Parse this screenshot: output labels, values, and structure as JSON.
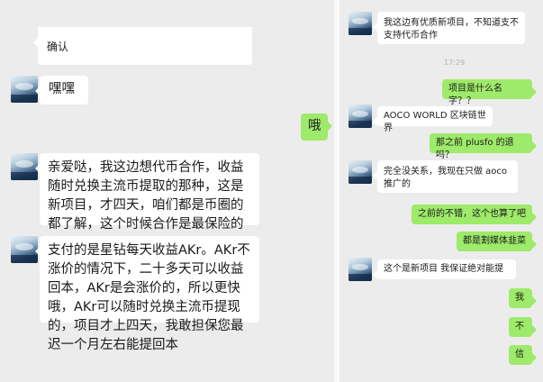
{
  "left_chat": {
    "messages": [
      {
        "side": "other",
        "text": "确认"
      },
      {
        "side": "other",
        "text": "嘿嘿"
      },
      {
        "side": "self",
        "text": "哦"
      },
      {
        "side": "other",
        "text": "亲爱哒，我这边想代币合作，收益随时兑换主流币提取的那种，这是新项目，才四天，咱们都是币圈的都了解，这个时候合作是最保险的"
      },
      {
        "side": "other",
        "text": "支付的是星钻每天收益AKr。AKr不涨价的情况下，二十多天可以收益回本，AKr是会涨价的，所以更快哦，AKr可以随时兑换主流币提现的，项目才上四天，我敢担保您最迟一个月左右能提回本"
      }
    ]
  },
  "right_chat": {
    "messages": [
      {
        "side": "other",
        "text": "我这边有优质新项目，不知道支不支持代币合作"
      },
      {
        "side": "time",
        "text": "17:29"
      },
      {
        "side": "self",
        "text": "项目是什么名字？？"
      },
      {
        "side": "other",
        "text": "AOCO WORLD 区块链世界"
      },
      {
        "side": "self",
        "text": "那之前 plusfo 的退吗？"
      },
      {
        "side": "other",
        "text": "完全没关系，我现在只做 aoco 推广的"
      },
      {
        "side": "self",
        "text": "之前的不错，这个也算了吧"
      },
      {
        "side": "self",
        "text": "都是割媒体韭菜"
      },
      {
        "side": "other",
        "text": "这个是新项目 我保证绝对能提"
      },
      {
        "side": "self",
        "text": "我"
      },
      {
        "side": "self",
        "text": "不"
      },
      {
        "side": "self",
        "text": "信"
      }
    ]
  }
}
